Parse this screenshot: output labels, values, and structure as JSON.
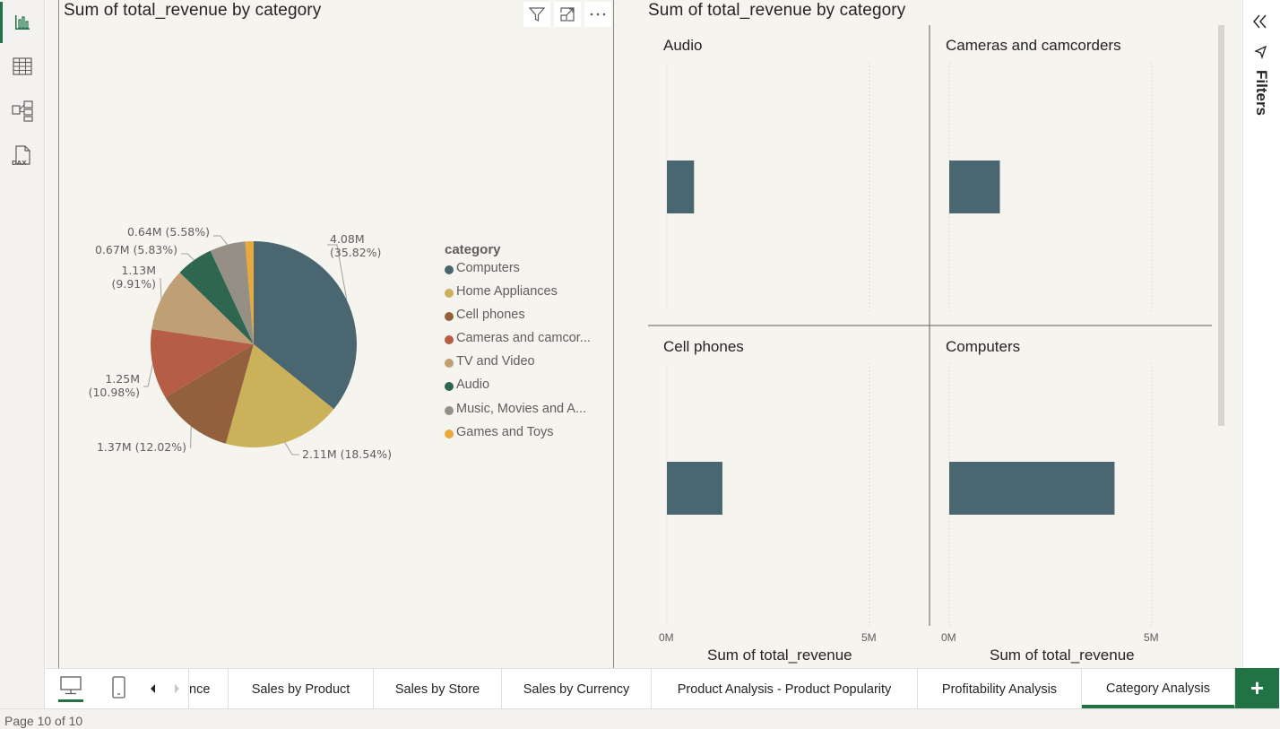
{
  "rail": {
    "items": [
      {
        "name": "report-view"
      },
      {
        "name": "table-view"
      },
      {
        "name": "model-view"
      },
      {
        "name": "dax-query-view",
        "label": "DAX"
      }
    ]
  },
  "left_visual": {
    "title": "Sum of total_revenue by category",
    "header_icons": [
      "filter-icon",
      "focus-mode-icon",
      "more-options-icon"
    ]
  },
  "right_visual": {
    "title": "Sum of total_revenue by category"
  },
  "filters_pane": {
    "label": "Filters"
  },
  "tabs": [
    {
      "label": "nce",
      "active": false
    },
    {
      "label": "Sales by Product",
      "active": false
    },
    {
      "label": "Sales by Store",
      "active": false
    },
    {
      "label": "Sales by Currency",
      "active": false
    },
    {
      "label": "Product Analysis - Product Popularity",
      "active": false
    },
    {
      "label": "Profitability Analysis",
      "active": false
    },
    {
      "label": "Category Analysis",
      "active": true
    }
  ],
  "add_tab_label": "+",
  "status": {
    "page_text": "Page 10 of 10"
  },
  "colors": {
    "accent": "#217346",
    "Computers": "#4a6670",
    "Home Appliances": "#ccb15b",
    "Cell phones": "#93603d",
    "Cameras and camcorders": "#b55d45",
    "TV and Video": "#bf9f73",
    "Audio": "#2e6650",
    "Music, Movies and Audio Books": "#958f85",
    "Games and Toys": "#e6a93a"
  },
  "chart_data": [
    {
      "type": "pie",
      "title": "Sum of total_revenue by category",
      "legend_title": "category",
      "legend_position": "right",
      "legend_entries": [
        "Computers",
        "Home Appliances",
        "Cell phones",
        "Cameras and camcor...",
        "TV and Video",
        "Audio",
        "Music, Movies and A...",
        "Games and Toys"
      ],
      "slices": [
        {
          "category": "Computers",
          "value": 4.08,
          "percent": 35.82,
          "label_line1": "4.08M",
          "label_line2": "(35.82%)"
        },
        {
          "category": "Home Appliances",
          "value": 2.11,
          "percent": 18.54,
          "label_line1": "2.11M (18.54%)",
          "label_line2": ""
        },
        {
          "category": "Cell phones",
          "value": 1.37,
          "percent": 12.02,
          "label_line1": "1.37M (12.02%)",
          "label_line2": ""
        },
        {
          "category": "Cameras and camcorders",
          "value": 1.25,
          "percent": 10.98,
          "label_line1": "1.25M",
          "label_line2": "(10.98%)"
        },
        {
          "category": "TV and Video",
          "value": 1.13,
          "percent": 9.91,
          "label_line1": "1.13M",
          "label_line2": "(9.91%)"
        },
        {
          "category": "Audio",
          "value": 0.67,
          "percent": 5.83,
          "label_line1": "0.67M (5.83%)",
          "label_line2": ""
        },
        {
          "category": "Music, Movies and Audio Books",
          "value": 0.64,
          "percent": 5.58,
          "label_line1": "0.64M (5.58%)",
          "label_line2": ""
        },
        {
          "category": "Games and Toys",
          "value": 0.16,
          "percent": 1.32,
          "label_line1": "",
          "label_line2": ""
        }
      ],
      "value_unit": "M"
    },
    {
      "type": "bar",
      "title": "Sum of total_revenue by category",
      "orientation": "horizontal",
      "small_multiples": true,
      "xlabel": "Sum of total_revenue",
      "xlim": [
        0,
        5
      ],
      "x_ticks": [
        "0M",
        "5M"
      ],
      "panels": [
        {
          "category": "Audio",
          "value": 0.67
        },
        {
          "category": "Cameras and camcorders",
          "value": 1.25
        },
        {
          "category": "Cell phones",
          "value": 1.37
        },
        {
          "category": "Computers",
          "value": 4.08
        }
      ],
      "bar_color": "#4a6670"
    }
  ]
}
